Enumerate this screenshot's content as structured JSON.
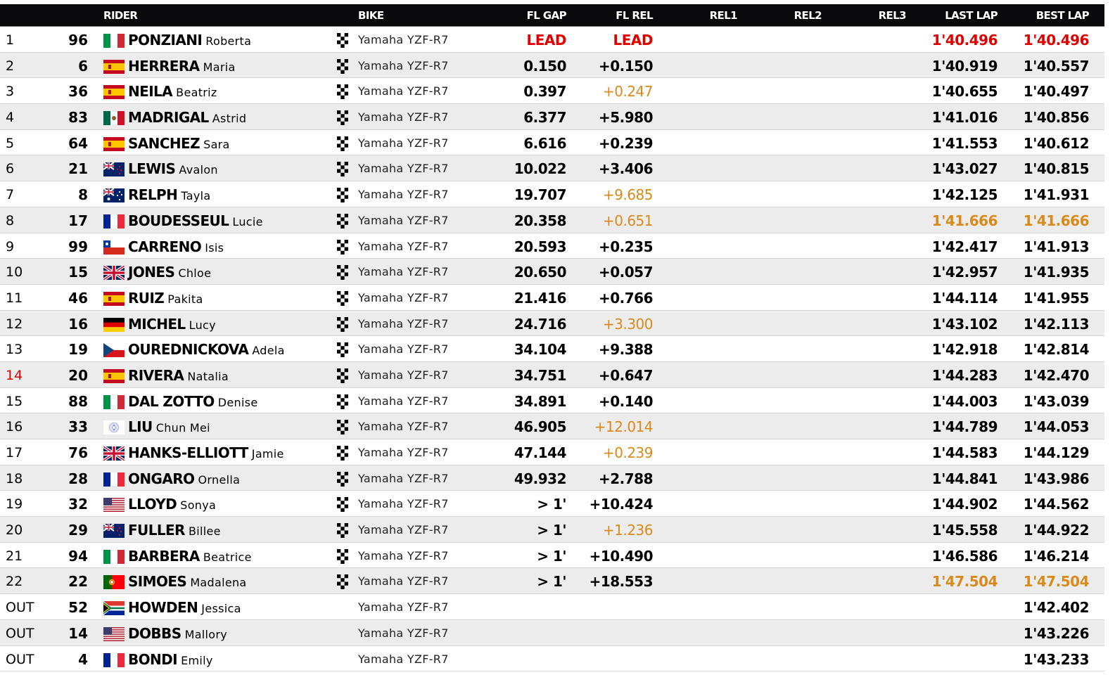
{
  "colors": {
    "header_bg": "#0a0a0c",
    "leader": "#e00000",
    "improved": "#d88a1a",
    "row_alt": "#ececec",
    "penalty_pos": "#e00000"
  },
  "header": {
    "rider": "RIDER",
    "bike": "BIKE",
    "fl_gap": "FL GAP",
    "fl_rel": "FL REL",
    "rel1": "REL1",
    "rel2": "REL2",
    "rel3": "REL3",
    "last_lap": "LAST LAP",
    "best_lap": "BEST LAP"
  },
  "rows": [
    {
      "pos": "1",
      "num": "96",
      "flag": "italy-flag",
      "surname": "PONZIANI",
      "name": "Roberta",
      "bike": "Yamaha YZF-R7",
      "gap": "LEAD",
      "rel": "LEAD",
      "last": "1'40.496",
      "best": "1'40.496",
      "gap_c": "red",
      "rel_c": "red",
      "last_c": "red",
      "best_c": "red",
      "chk": true
    },
    {
      "pos": "2",
      "num": "6",
      "flag": "spain-flag",
      "surname": "HERRERA",
      "name": "Maria",
      "bike": "Yamaha YZF-R7",
      "gap": "0.150",
      "rel": "+0.150",
      "last": "1'40.919",
      "best": "1'40.557",
      "chk": true
    },
    {
      "pos": "3",
      "num": "36",
      "flag": "spain-flag",
      "surname": "NEILA",
      "name": "Beatriz",
      "bike": "Yamaha YZF-R7",
      "gap": "0.397",
      "rel": "+0.247",
      "last": "1'40.655",
      "best": "1'40.497",
      "rel_c": "orange",
      "chk": true
    },
    {
      "pos": "4",
      "num": "83",
      "flag": "mexico-flag",
      "surname": "MADRIGAL",
      "name": "Astrid",
      "bike": "Yamaha YZF-R7",
      "gap": "6.377",
      "rel": "+5.980",
      "last": "1'41.016",
      "best": "1'40.856",
      "chk": true
    },
    {
      "pos": "5",
      "num": "64",
      "flag": "spain-flag",
      "surname": "SANCHEZ",
      "name": "Sara",
      "bike": "Yamaha YZF-R7",
      "gap": "6.616",
      "rel": "+0.239",
      "last": "1'41.553",
      "best": "1'40.612",
      "chk": true
    },
    {
      "pos": "6",
      "num": "21",
      "flag": "new-zealand-flag",
      "surname": "LEWIS",
      "name": "Avalon",
      "bike": "Yamaha YZF-R7",
      "gap": "10.022",
      "rel": "+3.406",
      "last": "1'43.027",
      "best": "1'40.815",
      "chk": true
    },
    {
      "pos": "7",
      "num": "8",
      "flag": "australia-flag",
      "surname": "RELPH",
      "name": "Tayla",
      "bike": "Yamaha YZF-R7",
      "gap": "19.707",
      "rel": "+9.685",
      "last": "1'42.125",
      "best": "1'41.931",
      "rel_c": "orange",
      "chk": true
    },
    {
      "pos": "8",
      "num": "17",
      "flag": "france-flag",
      "surname": "BOUDESSEUL",
      "name": "Lucie",
      "bike": "Yamaha YZF-R7",
      "gap": "20.358",
      "rel": "+0.651",
      "last": "1'41.666",
      "best": "1'41.666",
      "rel_c": "orange",
      "last_c": "orange",
      "best_c": "orange",
      "chk": true
    },
    {
      "pos": "9",
      "num": "99",
      "flag": "chile-flag",
      "surname": "CARRENO",
      "name": "Isis",
      "bike": "Yamaha YZF-R7",
      "gap": "20.593",
      "rel": "+0.235",
      "last": "1'42.417",
      "best": "1'41.913",
      "chk": true
    },
    {
      "pos": "10",
      "num": "15",
      "flag": "uk-flag",
      "surname": "JONES",
      "name": "Chloe",
      "bike": "Yamaha YZF-R7",
      "gap": "20.650",
      "rel": "+0.057",
      "last": "1'42.957",
      "best": "1'41.935",
      "chk": true
    },
    {
      "pos": "11",
      "num": "46",
      "flag": "spain-flag",
      "surname": "RUIZ",
      "name": "Pakita",
      "bike": "Yamaha YZF-R7",
      "gap": "21.416",
      "rel": "+0.766",
      "last": "1'44.114",
      "best": "1'41.955",
      "chk": true
    },
    {
      "pos": "12",
      "num": "16",
      "flag": "germany-flag",
      "surname": "MICHEL",
      "name": "Lucy",
      "bike": "Yamaha YZF-R7",
      "gap": "24.716",
      "rel": "+3.300",
      "last": "1'43.102",
      "best": "1'42.113",
      "rel_c": "orange",
      "chk": true
    },
    {
      "pos": "13",
      "num": "19",
      "flag": "czech-flag",
      "surname": "OUREDNICKOVA",
      "name": "Adela",
      "bike": "Yamaha YZF-R7",
      "gap": "34.104",
      "rel": "+9.388",
      "last": "1'42.918",
      "best": "1'42.814",
      "chk": true
    },
    {
      "pos": "14",
      "num": "20",
      "flag": "spain-flag",
      "surname": "RIVERA",
      "name": "Natalia",
      "bike": "Yamaha YZF-R7",
      "gap": "34.751",
      "rel": "+0.647",
      "last": "1'44.283",
      "best": "1'42.470",
      "pos_c": "red",
      "chk": true
    },
    {
      "pos": "15",
      "num": "88",
      "flag": "italy-flag",
      "surname": "DAL ZOTTO",
      "name": "Denise",
      "bike": "Yamaha YZF-R7",
      "gap": "34.891",
      "rel": "+0.140",
      "last": "1'44.003",
      "best": "1'43.039",
      "chk": true
    },
    {
      "pos": "16",
      "num": "33",
      "flag": "chinese-taipei-flag",
      "surname": "LIU",
      "name": "Chun Mei",
      "bike": "Yamaha YZF-R7",
      "gap": "46.905",
      "rel": "+12.014",
      "last": "1'44.789",
      "best": "1'44.053",
      "rel_c": "orange",
      "chk": true
    },
    {
      "pos": "17",
      "num": "76",
      "flag": "uk-flag",
      "surname": "HANKS-ELLIOTT",
      "name": "Jamie",
      "bike": "Yamaha YZF-R7",
      "gap": "47.144",
      "rel": "+0.239",
      "last": "1'44.583",
      "best": "1'44.129",
      "rel_c": "orange",
      "chk": true
    },
    {
      "pos": "18",
      "num": "28",
      "flag": "france-flag",
      "surname": "ONGARO",
      "name": "Ornella",
      "bike": "Yamaha YZF-R7",
      "gap": "49.932",
      "rel": "+2.788",
      "last": "1'44.841",
      "best": "1'43.986",
      "chk": true
    },
    {
      "pos": "19",
      "num": "32",
      "flag": "usa-flag",
      "surname": "LLOYD",
      "name": "Sonya",
      "bike": "Yamaha YZF-R7",
      "gap": "> 1'",
      "rel": "+10.424",
      "last": "1'44.902",
      "best": "1'44.562",
      "chk": true
    },
    {
      "pos": "20",
      "num": "29",
      "flag": "new-zealand-flag",
      "surname": "FULLER",
      "name": "Billee",
      "bike": "Yamaha YZF-R7",
      "gap": "> 1'",
      "rel": "+1.236",
      "last": "1'45.558",
      "best": "1'44.922",
      "rel_c": "orange",
      "chk": true
    },
    {
      "pos": "21",
      "num": "94",
      "flag": "italy-flag",
      "surname": "BARBERA",
      "name": "Beatrice",
      "bike": "Yamaha YZF-R7",
      "gap": "> 1'",
      "rel": "+10.490",
      "last": "1'46.586",
      "best": "1'46.214",
      "chk": true
    },
    {
      "pos": "22",
      "num": "22",
      "flag": "portugal-flag",
      "surname": "SIMOES",
      "name": "Madalena",
      "bike": "Yamaha YZF-R7",
      "gap": "> 1'",
      "rel": "+18.553",
      "last": "1'47.504",
      "best": "1'47.504",
      "last_c": "orange",
      "best_c": "orange",
      "chk": true
    },
    {
      "pos": "OUT",
      "num": "52",
      "flag": "south-africa-flag",
      "surname": "HOWDEN",
      "name": "Jessica",
      "bike": "Yamaha YZF-R7",
      "gap": "",
      "rel": "",
      "last": "",
      "best": "1'42.402",
      "chk": false
    },
    {
      "pos": "OUT",
      "num": "14",
      "flag": "usa-flag",
      "surname": "DOBBS",
      "name": "Mallory",
      "bike": "Yamaha YZF-R7",
      "gap": "",
      "rel": "",
      "last": "",
      "best": "1'43.226",
      "chk": false
    },
    {
      "pos": "OUT",
      "num": "4",
      "flag": "france-flag",
      "surname": "BONDI",
      "name": "Emily",
      "bike": "Yamaha YZF-R7",
      "gap": "",
      "rel": "",
      "last": "",
      "best": "1'43.233",
      "chk": false
    }
  ]
}
